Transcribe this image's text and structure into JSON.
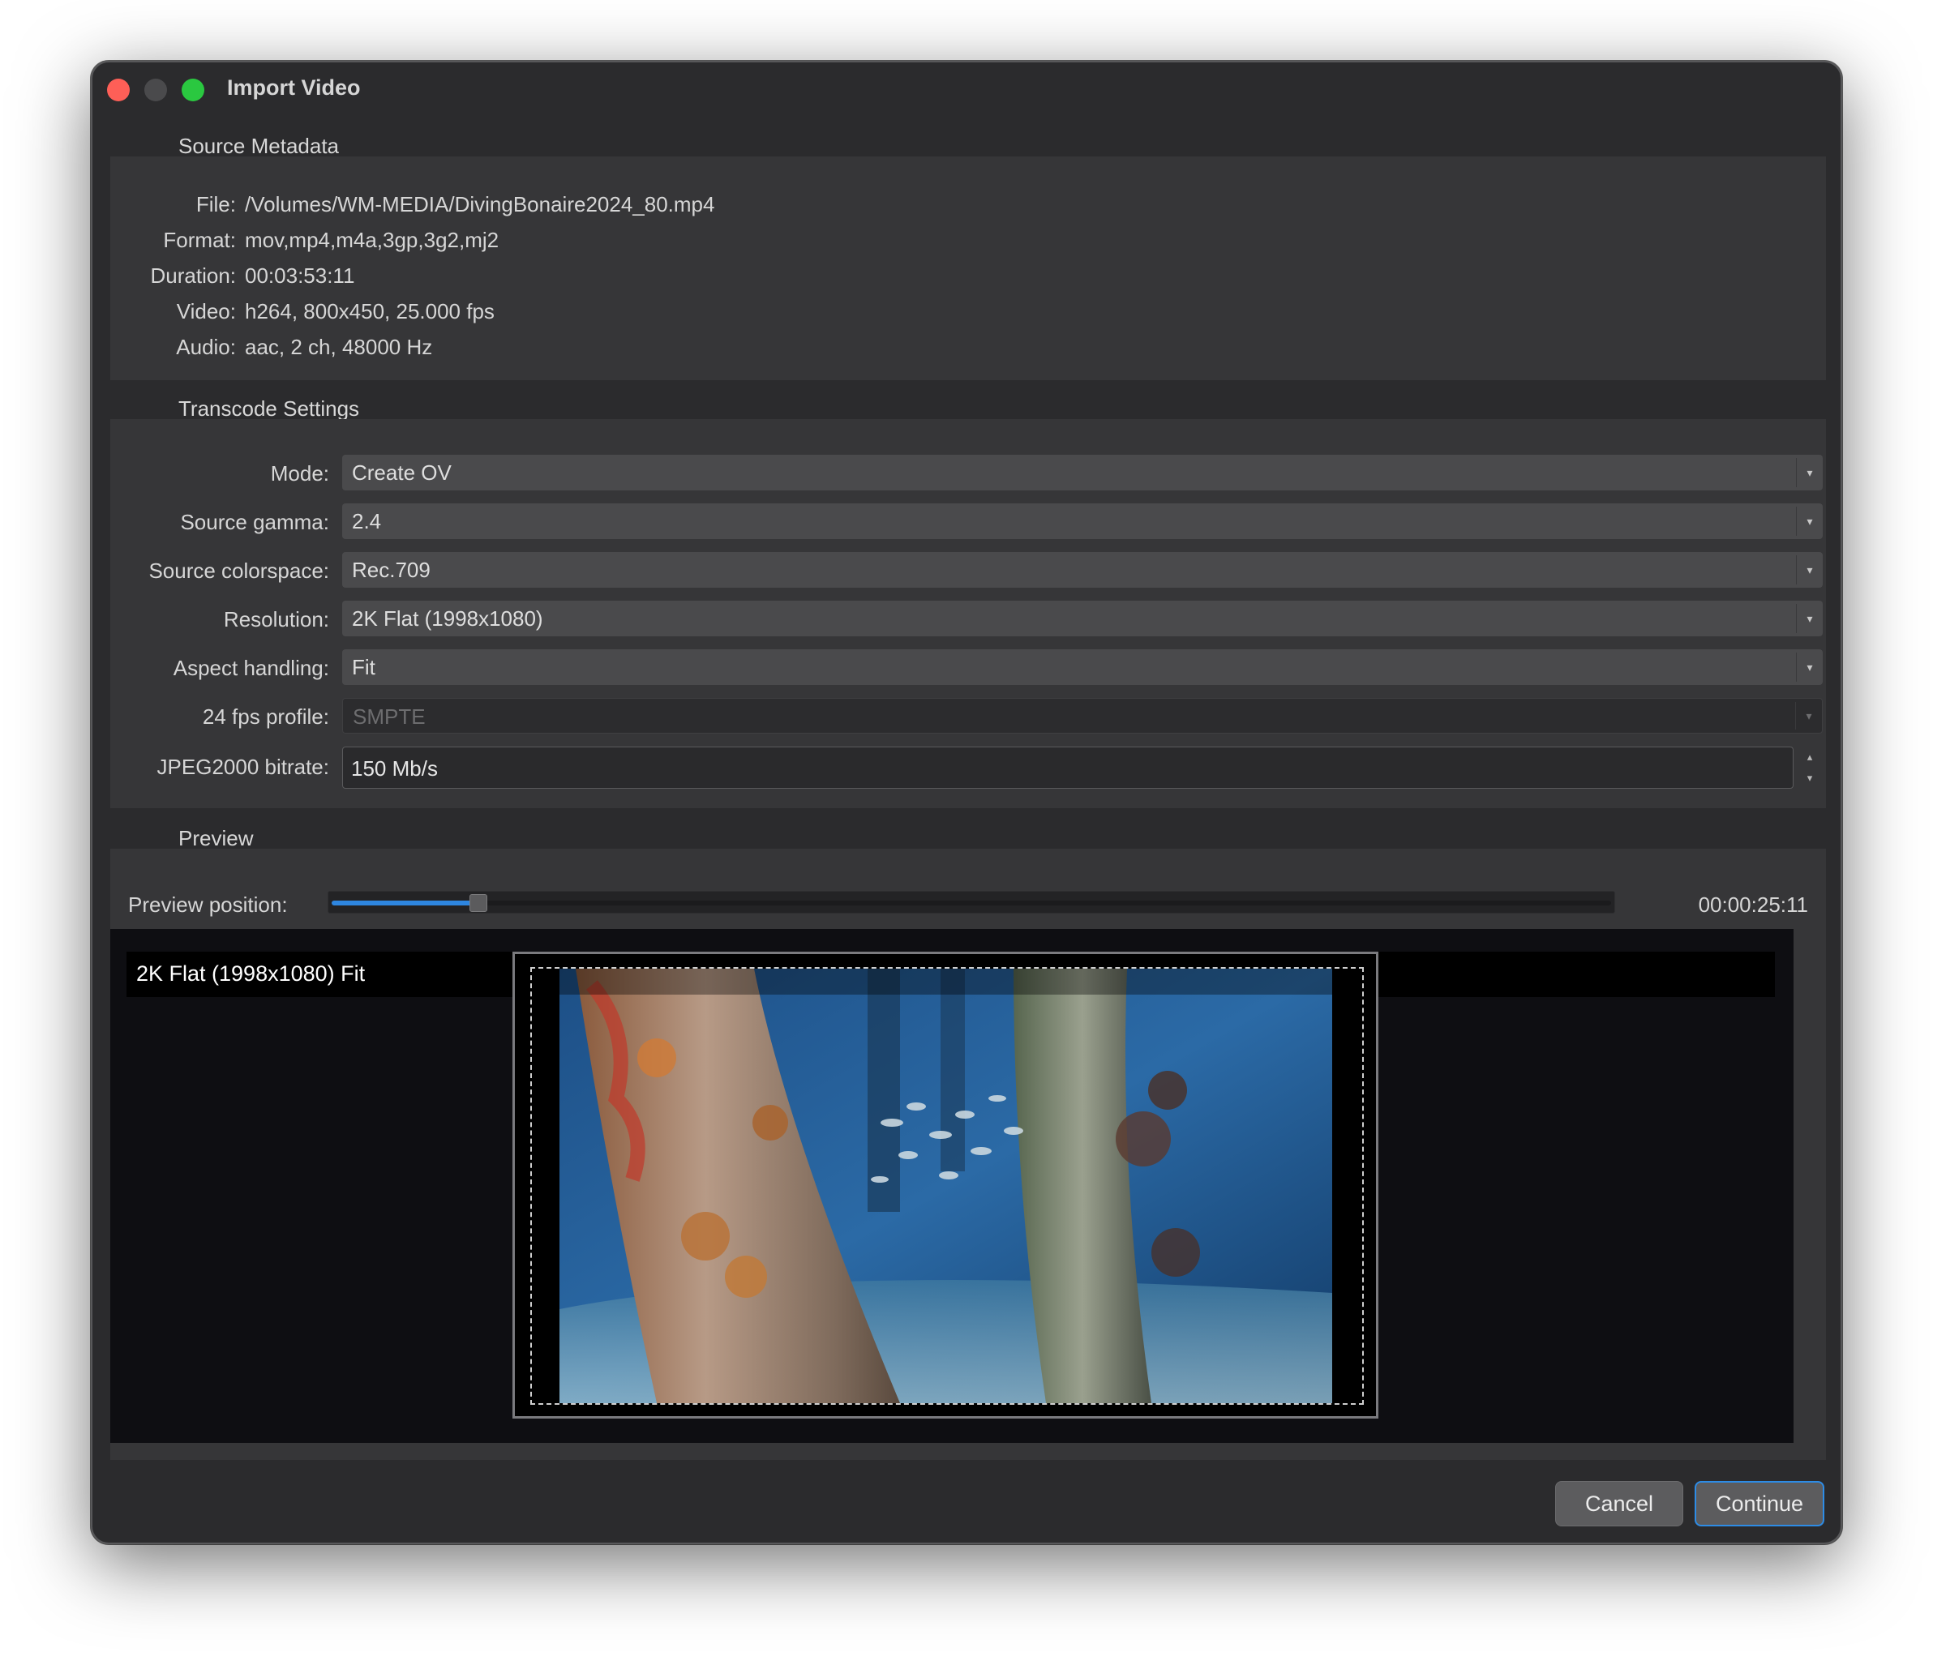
{
  "window": {
    "title": "Import Video"
  },
  "source_metadata": {
    "title": "Source Metadata",
    "rows": [
      {
        "label": "File:",
        "value": "/Volumes/WM-MEDIA/DivingBonaire2024_80.mp4"
      },
      {
        "label": "Format:",
        "value": "mov,mp4,m4a,3gp,3g2,mj2"
      },
      {
        "label": "Duration:",
        "value": "00:03:53:11"
      },
      {
        "label": "Video:",
        "value": "h264, 800x450, 25.000 fps"
      },
      {
        "label": "Audio:",
        "value": "aac, 2 ch, 48000 Hz"
      }
    ]
  },
  "transcode": {
    "title": "Transcode Settings",
    "mode": {
      "label": "Mode:",
      "value": "Create OV"
    },
    "gamma": {
      "label": "Source gamma:",
      "value": "2.4"
    },
    "colorspace": {
      "label": "Source colorspace:",
      "value": "Rec.709"
    },
    "resolution": {
      "label": "Resolution:",
      "value": "2K Flat (1998x1080)"
    },
    "aspect": {
      "label": "Aspect handling:",
      "value": "Fit"
    },
    "fps_profile": {
      "label": "24 fps profile:",
      "value": "SMPTE",
      "disabled": true
    },
    "bitrate": {
      "label": "JPEG2000 bitrate:",
      "value": "150 Mb/s"
    }
  },
  "preview": {
    "title": "Preview",
    "position_label": "Preview position:",
    "position_fraction": 0.115,
    "timecode": "00:00:25:11",
    "caption": "2K Flat (1998x1080)  Fit"
  },
  "buttons": {
    "cancel": "Cancel",
    "continue": "Continue"
  },
  "colors": {
    "window_bg": "#2b2b2d",
    "panel_bg": "#363638",
    "accent": "#2e86e0",
    "close": "#fe5f57",
    "zoom": "#2ac840"
  }
}
